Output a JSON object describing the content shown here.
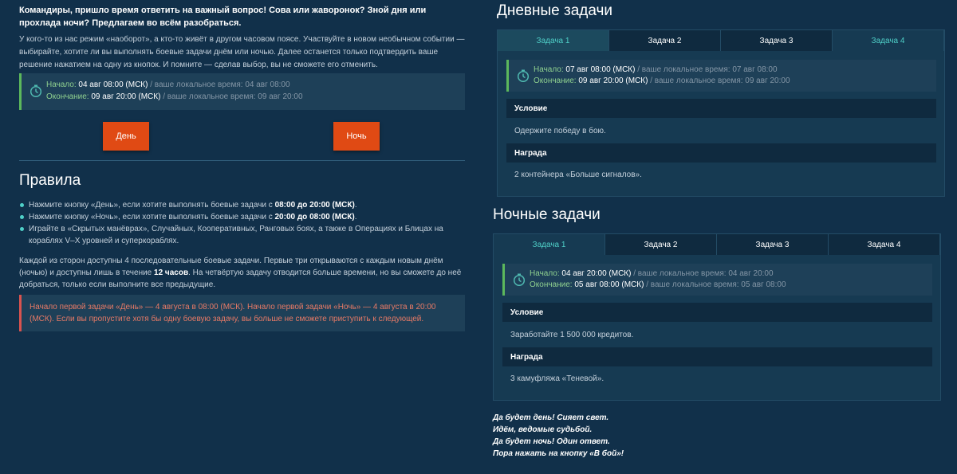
{
  "intro": {
    "title": "Командиры, пришло время ответить на важный вопрос! Сова или жаворонок? Зной дня или прохлада ночи? Предлагаем во всём разобраться.",
    "text": "У кого-то из нас режим «наоборот», а кто-то живёт в другом часовом поясе. Участвуйте в новом необычном событии — выбирайте, хотите ли вы выполнять боевые задачи днём или ночью. Далее останется только подтвердить ваше решение нажатием на одну из кнопок. И помните — сделав выбор, вы не сможете его отменить."
  },
  "event_dates": {
    "start_label": "Начало:",
    "start_value": "04 авг 08:00 (МСК)",
    "start_local": "/ ваше локальное время: 04 авг 08:00",
    "end_label": "Окончание:",
    "end_value": "09 авг 20:00 (МСК)",
    "end_local": "/ ваше локальное время: 09 авг 20:00"
  },
  "buttons": {
    "day": "День",
    "night": "Ночь"
  },
  "rules": {
    "title": "Правила",
    "items": [
      {
        "pre": "Нажмите кнопку «День», если хотите выполнять боевые задачи с ",
        "bold": "08:00 до 20:00 (МСК)",
        "post": "."
      },
      {
        "pre": "Нажмите кнопку «Ночь», если хотите выполнять боевые задачи с ",
        "bold": "20:00 до 08:00 (МСК)",
        "post": "."
      },
      {
        "pre": "Играйте в «Скрытых манёврах», Случайных, Кооперативных, Ранговых боях, а также в Операциях и Блицах на кораблях V–X уровней и суперкораблях.",
        "bold": "",
        "post": ""
      }
    ],
    "para_pre": "Каждой из сторон доступны 4 последовательные боевые задачи. Первые три открываются с каждым новым днём (ночью) и доступны лишь в течение ",
    "para_bold": "12 часов",
    "para_post": ". На четвёртую задачу отводится больше времени, но вы сможете до неё добраться, только если выполните все предыдущие.",
    "warning": "Начало первой задачи «День» — 4 августа в 08:00 (МСК). Начало первой задачи «Ночь» — 4 августа в 20:00 (МСК). Если вы пропустите хотя бы одну боевую задачу, вы больше не сможете приступить к следующей."
  },
  "day_tasks": {
    "title": "Дневные задачи",
    "tabs": [
      "Задача 1",
      "Задача 2",
      "Задача 3",
      "Задача 4"
    ],
    "start_label": "Начало:",
    "start_value": "07 авг 08:00 (МСК)",
    "start_local": "/ ваше локальное время: 07 авг 08:00",
    "end_label": "Окончание:",
    "end_value": "09 авг 20:00 (МСК)",
    "end_local": "/ ваше локальное время: 09 авг 20:00",
    "condition_label": "Условие",
    "condition": "Одержите победу в бою.",
    "reward_label": "Награда",
    "reward": "2 контейнера «Больше сигналов»."
  },
  "night_tasks": {
    "title": "Ночные задачи",
    "tabs": [
      "Задача 1",
      "Задача 2",
      "Задача 3",
      "Задача 4"
    ],
    "start_label": "Начало:",
    "start_value": "04 авг 20:00 (МСК)",
    "start_local": "/ ваше локальное время: 04 авг 20:00",
    "end_label": "Окончание:",
    "end_value": "05 авг 08:00 (МСК)",
    "end_local": "/ ваше локальное время: 05 авг 08:00",
    "condition_label": "Условие",
    "condition": "Заработайте 1 500 000 кредитов.",
    "reward_label": "Награда",
    "reward": "3 камуфляжа «Теневой»."
  },
  "poem": [
    "Да будет день! Сияет свет.",
    "Идём, ведомые судьбой.",
    "Да будет ночь! Один ответ.",
    "Пора нажать на кнопку «В бой»!"
  ]
}
